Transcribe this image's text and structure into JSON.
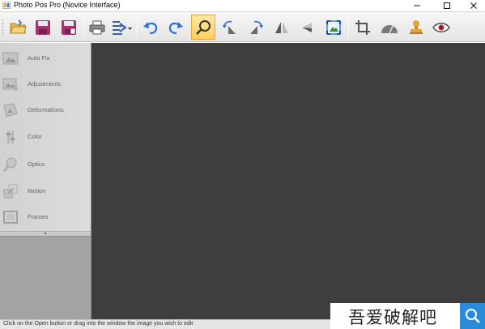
{
  "window": {
    "title": "Photo Pos Pro (Novice Interface)",
    "controls": [
      "minimize-icon",
      "maximize-icon",
      "close-icon"
    ]
  },
  "toolbar": {
    "buttons": [
      {
        "icon": "open-folder-icon",
        "state": "normal"
      },
      {
        "icon": "save-icon",
        "state": "normal"
      },
      {
        "icon": "save-as-icon",
        "state": "normal"
      },
      {
        "icon": "print-icon",
        "state": "normal"
      },
      {
        "icon": "batch-dropdown-icon",
        "state": "normal"
      },
      {
        "icon": "undo-icon",
        "state": "normal"
      },
      {
        "icon": "redo-icon",
        "state": "normal"
      },
      {
        "icon": "zoom-icon",
        "state": "active"
      },
      {
        "icon": "rotate-left-icon",
        "state": "normal"
      },
      {
        "icon": "rotate-right-icon",
        "state": "normal"
      },
      {
        "icon": "flip-horizontal-icon",
        "state": "normal"
      },
      {
        "icon": "flip-vertical-icon",
        "state": "normal"
      },
      {
        "icon": "resize-icon",
        "state": "normal"
      },
      {
        "icon": "crop-icon",
        "state": "normal"
      },
      {
        "icon": "straighten-icon",
        "state": "normal"
      },
      {
        "icon": "stamp-icon",
        "state": "normal"
      },
      {
        "icon": "red-eye-icon",
        "state": "normal"
      }
    ]
  },
  "sidebar": {
    "items": [
      {
        "label": "Auto Fix",
        "icon": "auto-fix-icon"
      },
      {
        "label": "Adjustments",
        "icon": "adjustments-icon"
      },
      {
        "label": "Deformations",
        "icon": "deformations-icon"
      },
      {
        "label": "Color",
        "icon": "color-icon"
      },
      {
        "label": "Optics",
        "icon": "optics-icon"
      },
      {
        "label": "Motion",
        "icon": "motion-icon"
      },
      {
        "label": "Frames",
        "icon": "frames-icon"
      }
    ]
  },
  "status": {
    "text": "Click on the Open button or drag into the window the image you wish to edit"
  },
  "watermark": {
    "text": "吾爱破解吧",
    "icon": "search-icon"
  },
  "colors": {
    "workspace": "#3e3e3e",
    "sidebar": "#d6d6d6",
    "accent_active": "#ffcf5c",
    "icon_blue": "#2f6fd1",
    "watermark_blue": "#2b8bd9"
  }
}
